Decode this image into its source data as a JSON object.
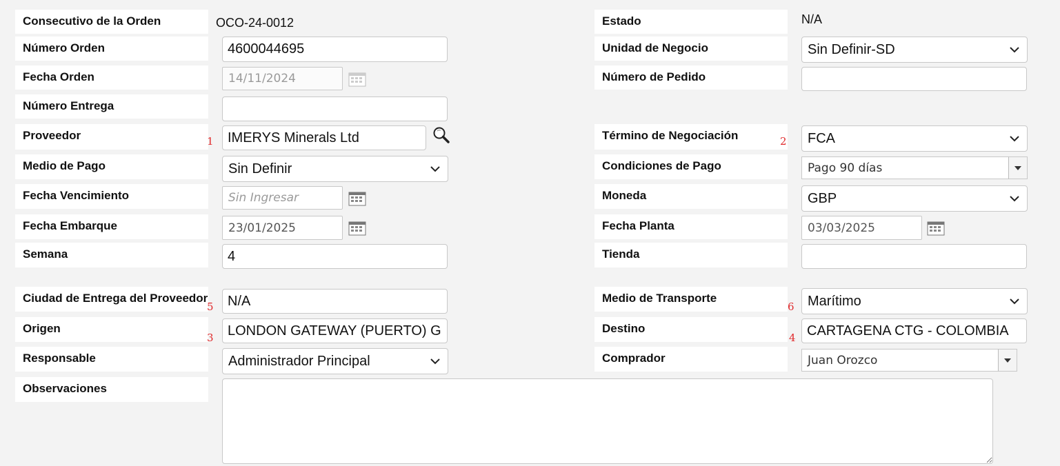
{
  "labels": {
    "consecutivo": "Consecutivo de la Orden",
    "estado": "Estado",
    "numero_orden": "Número Orden",
    "unidad_negocio": "Unidad de Negocio",
    "fecha_orden": "Fecha Orden",
    "numero_pedido": "Número de Pedido",
    "numero_entrega": "Número Entrega",
    "proveedor": "Proveedor",
    "termino_negociacion": "Término de Negociación",
    "medio_pago": "Medio de Pago",
    "condiciones_pago": "Condiciones de Pago",
    "fecha_vencimiento": "Fecha Vencimiento",
    "moneda": "Moneda",
    "fecha_embarque": "Fecha Embarque",
    "fecha_planta": "Fecha Planta",
    "semana": "Semana",
    "tienda": "Tienda",
    "ciudad_entrega": "Ciudad de Entrega del Proveedor",
    "medio_transporte": "Medio de Transporte",
    "origen": "Origen",
    "destino": "Destino",
    "responsable": "Responsable",
    "comprador": "Comprador",
    "observaciones": "Observaciones"
  },
  "values": {
    "consecutivo": "OCO-24-0012",
    "estado": "N/A",
    "numero_orden": "4600044695",
    "unidad_negocio": "Sin Definir-SD",
    "fecha_orden": "14/11/2024",
    "numero_pedido": "",
    "numero_entrega": "",
    "proveedor": "IMERYS Minerals Ltd",
    "termino_negociacion": "FCA",
    "medio_pago": "Sin Definir",
    "condiciones_pago": "Pago 90 días",
    "fecha_vencimiento_placeholder": "Sin Ingresar",
    "moneda": "GBP",
    "fecha_embarque": "23/01/2025",
    "fecha_planta": "03/03/2025",
    "semana": "4",
    "tienda": "",
    "ciudad_entrega": "N/A",
    "medio_transporte": "Marítimo",
    "origen": "LONDON GATEWAY (PUERTO) G",
    "destino": "CARTAGENA CTG - COLOMBIA",
    "responsable": "Administrador Principal",
    "comprador": "Juan Orozco",
    "observaciones": ""
  },
  "markers": {
    "m1": "1",
    "m2": "2",
    "m3": "3",
    "m4": "4",
    "m5": "5",
    "m6": "6"
  },
  "icons": {
    "search": "search-icon",
    "calendar": "calendar-icon",
    "chevron": "chevron-down-icon"
  },
  "colors": {
    "marker": "#e0282a",
    "page_background": "#f3f3f3"
  }
}
